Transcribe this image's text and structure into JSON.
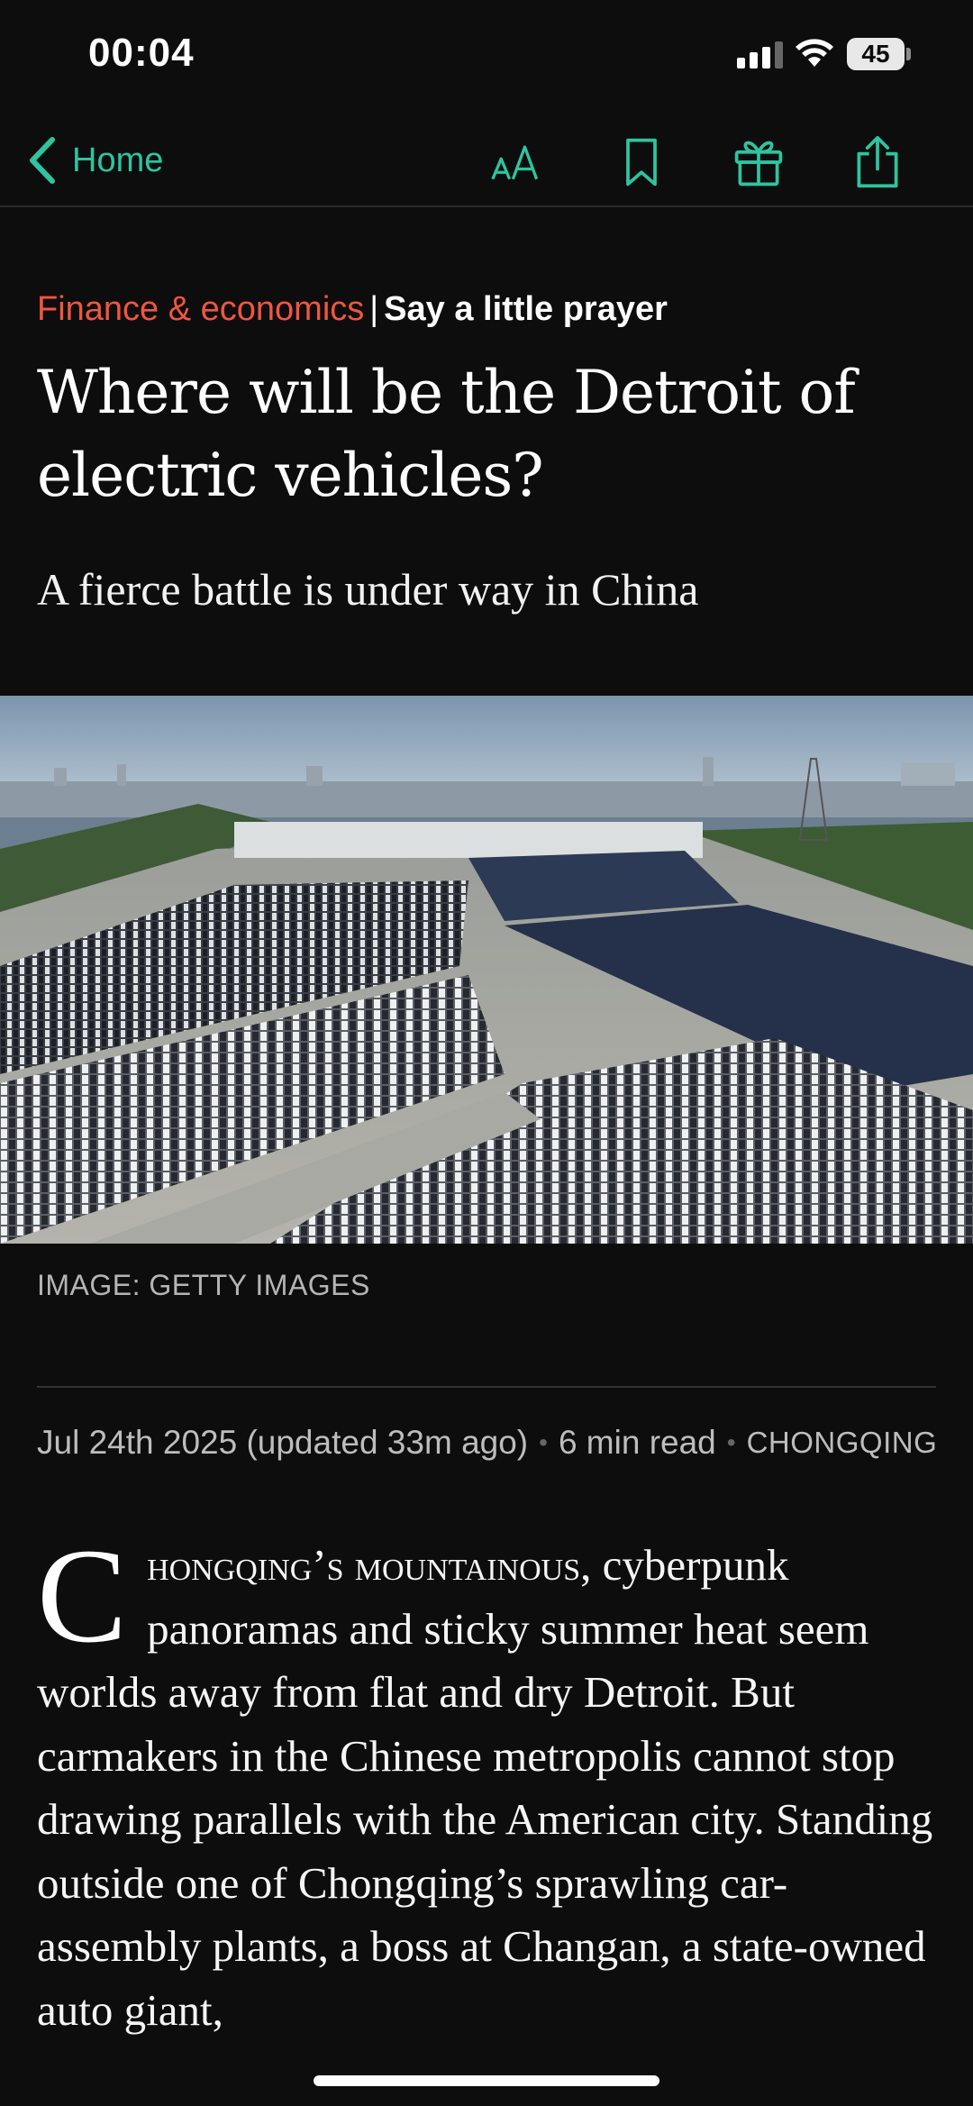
{
  "status_bar": {
    "time": "00:04",
    "battery": "45",
    "icons": [
      "signal-icon",
      "wifi-icon",
      "battery-icon"
    ]
  },
  "nav": {
    "back_label": "Home",
    "icons": [
      "chevron-left-icon",
      "text-size-icon",
      "bookmark-icon",
      "gift-icon",
      "share-icon"
    ],
    "accent_color": "#2ec4a0"
  },
  "article": {
    "section": "Finance & economics",
    "separator": "|",
    "fly_title": "Say a little prayer",
    "headline": "Where will be the Detroit of electric vehicles?",
    "standfirst": "A fierce battle is under way in China",
    "image_caption": "IMAGE: GETTY IMAGES",
    "date": "Jul 24th 2025 (updated 33m ago)",
    "read_time": "6 min read",
    "dateline": "CHONGQING",
    "dropcap": "C",
    "lead_smallcaps": "hongqing’s mountainous,",
    "body_rest": " cyberpunk panoramas and sticky summer heat seem worlds away from flat and dry Detroit. But carmakers in the Chinese metropolis cannot stop drawing parallels with the American city. Standing outside one of Chongqing’s sprawling car-assembly plants, a boss at Changan, a state-owned auto giant,",
    "section_color": "#f0563f"
  }
}
